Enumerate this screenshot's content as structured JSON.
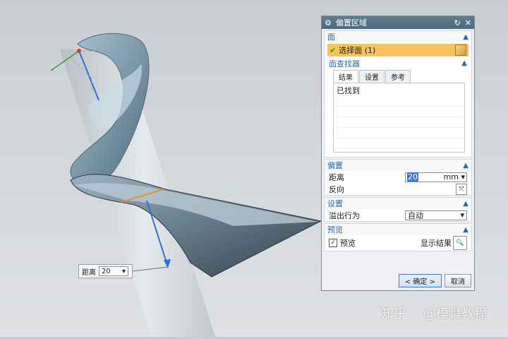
{
  "dialog": {
    "title": "偏置区域",
    "face_section": {
      "header": "面",
      "select_face_label": "选择面 (1)",
      "face_finder_header": "面查找器",
      "tabs": [
        "结果",
        "设置",
        "参考"
      ],
      "found_label": "已找到"
    },
    "offset_section": {
      "header": "偏置",
      "distance_label": "距离",
      "distance_value": "20",
      "distance_unit": "mm",
      "reverse_label": "反向"
    },
    "settings_section": {
      "header": "设置",
      "overflow_label": "溢出行为",
      "overflow_value": "自动"
    },
    "preview_section": {
      "header": "预览",
      "preview_label": "预览",
      "preview_checked": true,
      "show_result_label": "显示结果"
    },
    "ok_button": "< 确定 >",
    "cancel_button": "取消"
  },
  "viewport_widget": {
    "distance_label": "距离",
    "distance_value": "20"
  },
  "watermark": {
    "left_text": "知乎",
    "right_text": "@模具教程"
  }
}
